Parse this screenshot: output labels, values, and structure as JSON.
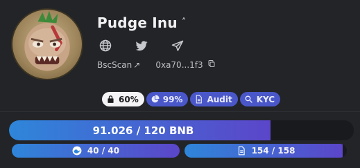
{
  "token": {
    "name": "Pudge Inu",
    "title_caret": "^",
    "avatar_icon": "pudge-avatar"
  },
  "socials": [
    {
      "icon": "globe-icon"
    },
    {
      "icon": "twitter-icon"
    },
    {
      "icon": "telegram-icon"
    }
  ],
  "links": {
    "explorer_label": "BscScan",
    "explorer_arrow": "↗",
    "address_short": "0xa70...1f3",
    "copy_icon": "copy-icon"
  },
  "badges": [
    {
      "icon": "lock-icon",
      "label": "60%",
      "style": "white"
    },
    {
      "icon": "pie-chart-icon",
      "label": "99%",
      "style": "blue"
    },
    {
      "icon": "document-icon",
      "label": "Audit",
      "style": "blue"
    },
    {
      "icon": "search-icon",
      "label": "KYC",
      "style": "blue"
    }
  ],
  "progress": {
    "raised_label": "91.026 / 120 BNB",
    "raised_fraction": 0.7585,
    "left_stat": {
      "icon": "wave-icon",
      "label": "40 / 40",
      "fraction": 1.0
    },
    "right_stat": {
      "icon": "document-icon",
      "label": "154 / 158",
      "fraction": 0.975
    }
  },
  "colors": {
    "background": "#232427",
    "accent_blue": "#4a57c8",
    "bar_gradient_start": "#2e86da",
    "bar_gradient_end": "#5b46c9"
  }
}
